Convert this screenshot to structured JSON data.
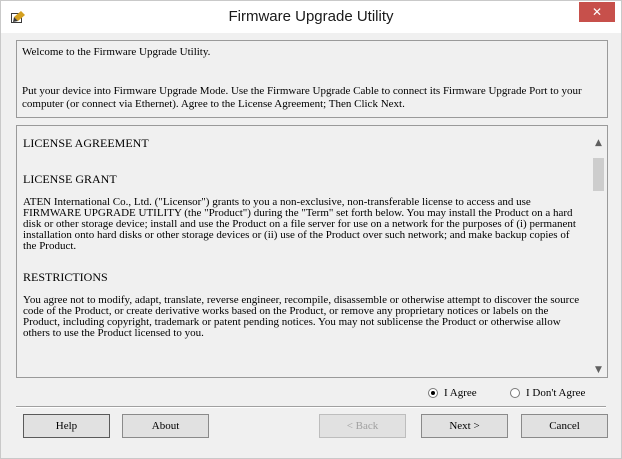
{
  "window": {
    "title": "Firmware Upgrade Utility"
  },
  "intro": {
    "welcome": "Welcome to the Firmware Upgrade Utility.",
    "instructions": "Put your device into Firmware Upgrade Mode. Use the Firmware Upgrade Cable to connect its Firmware Upgrade Port to your computer (or connect via Ethernet). Agree to the License Agreement; Then Click Next."
  },
  "license": {
    "title": "LICENSE AGREEMENT",
    "grant_heading": "LICENSE GRANT",
    "grant_text": "ATEN International Co., Ltd. (\"Licensor\") grants to you a non-exclusive, non-transferable license to access and use FIRMWARE UPGRADE UTILITY (the \"Product\") during the \"Term\" set forth below. You may install the Product on a hard disk or other storage device; install and use the Product on a file server for use on a network for the purposes of (i) permanent installation onto hard disks or other storage devices or (ii) use of the Product over such network; and make backup copies of the Product.",
    "restrictions_heading": "RESTRICTIONS",
    "restrictions_text": "You agree not to modify, adapt, translate, reverse engineer, recompile, disassemble or otherwise attempt to discover the source code of the Product, or create derivative works based on the Product, or remove any proprietary notices or labels on the Product, including copyright, trademark or patent pending notices. You may not sublicense the Product or otherwise allow others to use the Product licensed to you."
  },
  "agreement": {
    "agree_label": "I Agree",
    "disagree_label": "I Don't Agree",
    "selected": "agree"
  },
  "buttons": {
    "help": "Help",
    "about": "About",
    "back": "< Back",
    "next": "Next >",
    "cancel": "Cancel"
  },
  "colors": {
    "close_button": "#c7504b",
    "dialog_bg": "#f0f0f0"
  },
  "icons": {
    "app": "firmware-app-icon",
    "close": "close-icon",
    "scroll_up": "chevron-up-icon",
    "scroll_down": "chevron-down-icon"
  }
}
